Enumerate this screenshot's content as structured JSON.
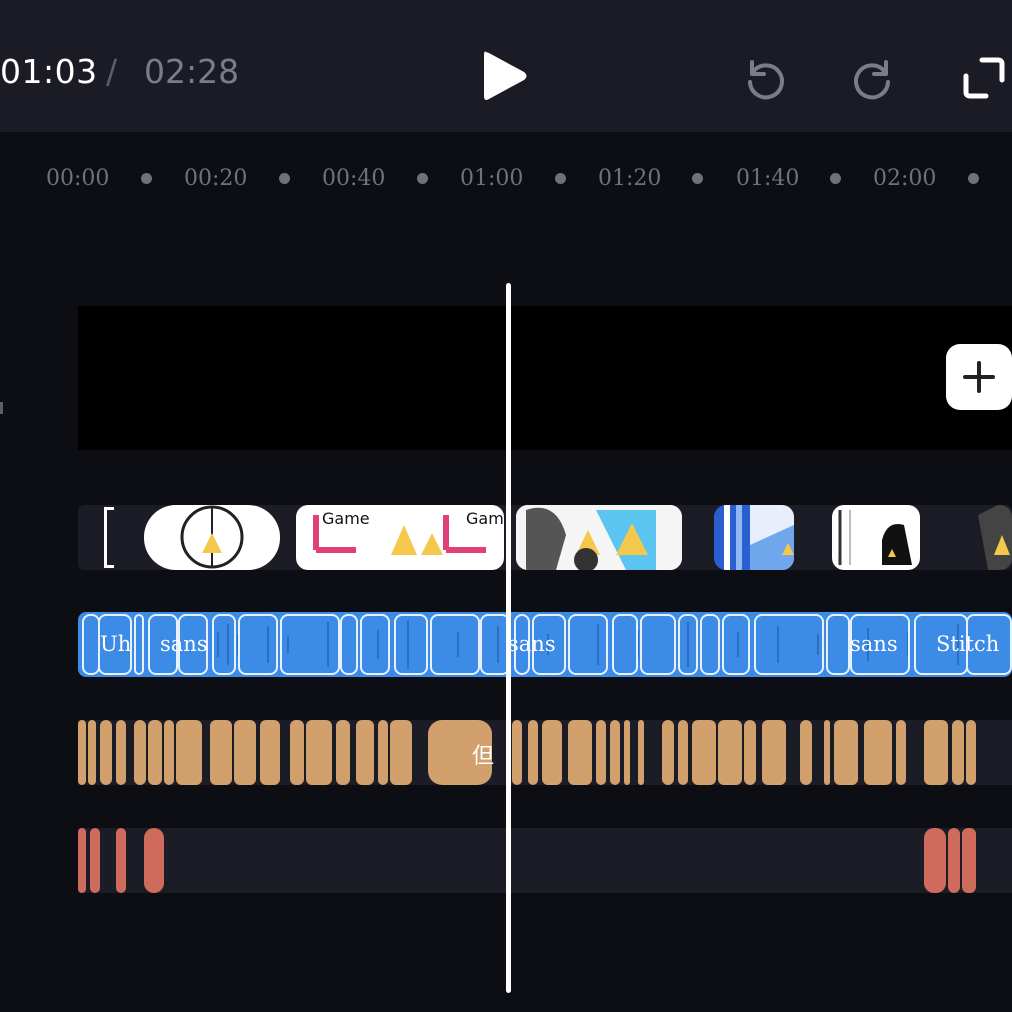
{
  "header": {
    "current_time": "01:03",
    "separator": "/",
    "total_time": "02:28",
    "play_icon": "play-icon",
    "undo_icon": "undo-icon",
    "redo_icon": "redo-icon",
    "fullscreen_icon": "fullscreen-icon"
  },
  "ruler": {
    "ticks": [
      "00:00",
      "00:20",
      "00:40",
      "01:00",
      "01:20",
      "01:40",
      "02:00"
    ]
  },
  "main_track": {
    "add_icon": "plus-icon"
  },
  "thumbnail_track": {
    "labels": [
      "Game",
      "Gam"
    ]
  },
  "audio_track": {
    "labels": [
      "Uh",
      "sans",
      "sans",
      "sans",
      "Stitch"
    ]
  },
  "caption_track": {
    "label": "但"
  },
  "colors": {
    "background": "#0d0e14",
    "header": "#1a1b25",
    "audio": "#3c8be6",
    "caption": "#d2a06c",
    "effect": "#cf6b5d",
    "playhead": "#ffffff"
  }
}
